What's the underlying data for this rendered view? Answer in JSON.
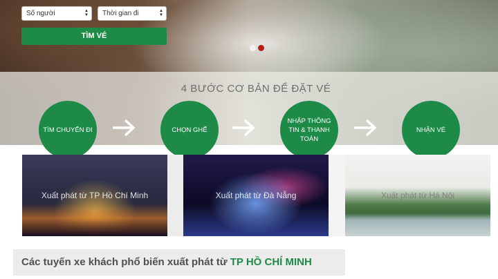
{
  "search": {
    "people_select": "Số người",
    "time_select": "Thời gian đi",
    "button_label": "TÌM VÉ"
  },
  "steps": {
    "title": "4 BƯỚC CƠ BẢN ĐỂ ĐẶT VÉ",
    "items": [
      {
        "label": "TÌM CHUYẾN ĐI"
      },
      {
        "label": "CHỌN GHẾ"
      },
      {
        "label": "NHẬP THÔNG TIN & THANH TOÁN"
      },
      {
        "label": "NHẬN VÉ"
      }
    ]
  },
  "cards": [
    {
      "label": "Xuất phát từ TP Hồ Chí Minh"
    },
    {
      "label": "Xuất phát từ Đà Nẵng"
    },
    {
      "label": "Xuất phát từ Hà Nội"
    }
  ],
  "routes": {
    "title_prefix": "Các tuyến xe khách phổ biến xuất phát từ",
    "city": "TP HỒ CHÍ MINH"
  },
  "colors": {
    "accent": "#1e8a47",
    "carousel_active": "#b71c1c"
  }
}
